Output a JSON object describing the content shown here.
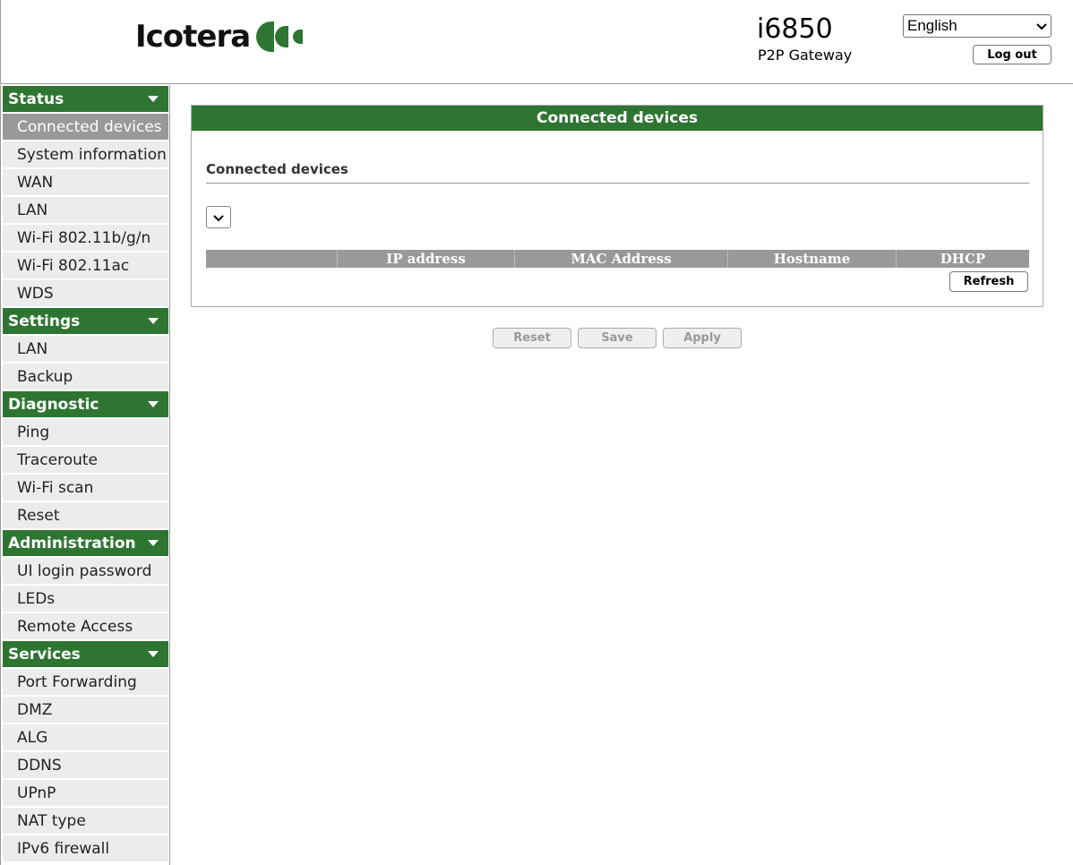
{
  "header": {
    "logo_text": "Icotera",
    "model": "i6850",
    "model_sub": "P2P Gateway",
    "language": "English",
    "logout_label": "Log out"
  },
  "sidebar": {
    "sections": [
      {
        "title": "Status",
        "items": [
          "Connected devices",
          "System information",
          "WAN",
          "LAN",
          "Wi-Fi 802.11b/g/n",
          "Wi-Fi 802.11ac",
          "WDS"
        ]
      },
      {
        "title": "Settings",
        "items": [
          "LAN",
          "Backup"
        ]
      },
      {
        "title": "Diagnostic",
        "items": [
          "Ping",
          "Traceroute",
          "Wi-Fi scan",
          "Reset"
        ]
      },
      {
        "title": "Administration",
        "items": [
          "UI login password",
          "LEDs",
          "Remote Access"
        ]
      },
      {
        "title": "Services",
        "items": [
          "Port Forwarding",
          "DMZ",
          "ALG",
          "DDNS",
          "UPnP",
          "NAT type",
          "IPv6 firewall"
        ]
      }
    ],
    "active_item": "Connected devices"
  },
  "main": {
    "panel_title": "Connected devices",
    "subheading": "Connected devices",
    "table_headers": [
      "",
      "IP address",
      "MAC Address",
      "Hostname",
      "DHCP"
    ],
    "refresh_label": "Refresh",
    "buttons": {
      "reset": "Reset",
      "save": "Save",
      "apply": "Apply"
    }
  },
  "colors": {
    "accent_green": "#2e7532",
    "header_gray": "#999999",
    "item_bg": "#ececec"
  }
}
